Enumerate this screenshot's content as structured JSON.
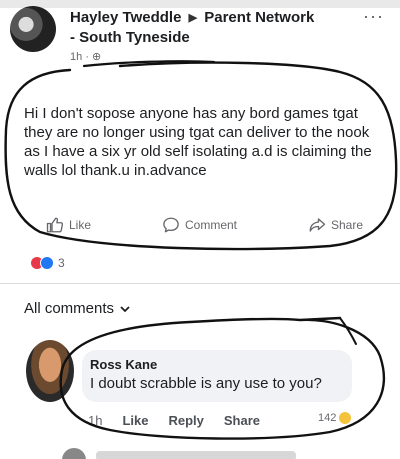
{
  "post": {
    "author": "Hayley Tweddle",
    "group_name": "Parent Network",
    "group_location": "- South Tyneside",
    "timestamp": "1h",
    "body": "Hi I don't sopose anyone has any bord games tgat they are no longer using tgat can deliver to the nook as I have a six yr old self isolating a.d is claiming the walls lol  thank.u in.advance"
  },
  "actions": {
    "like": "Like",
    "comment": "Comment",
    "share": "Share"
  },
  "reactions": {
    "count": "3"
  },
  "comments_filter": "All comments",
  "comment": {
    "author": "Ross Kane",
    "text": "I doubt scrabble is any use to you?",
    "time": "1h",
    "like": "Like",
    "reply": "Reply",
    "share": "Share",
    "reaction_count": "142"
  },
  "colors": {
    "accent": "#2078f4",
    "love": "#e8394a",
    "ink": "#111111"
  },
  "icons": {
    "more": "more-dots-icon",
    "like": "thumbs-up-icon",
    "comment": "speech-bubble-icon",
    "share": "share-arrow-icon",
    "chevron": "chevron-down-icon"
  }
}
